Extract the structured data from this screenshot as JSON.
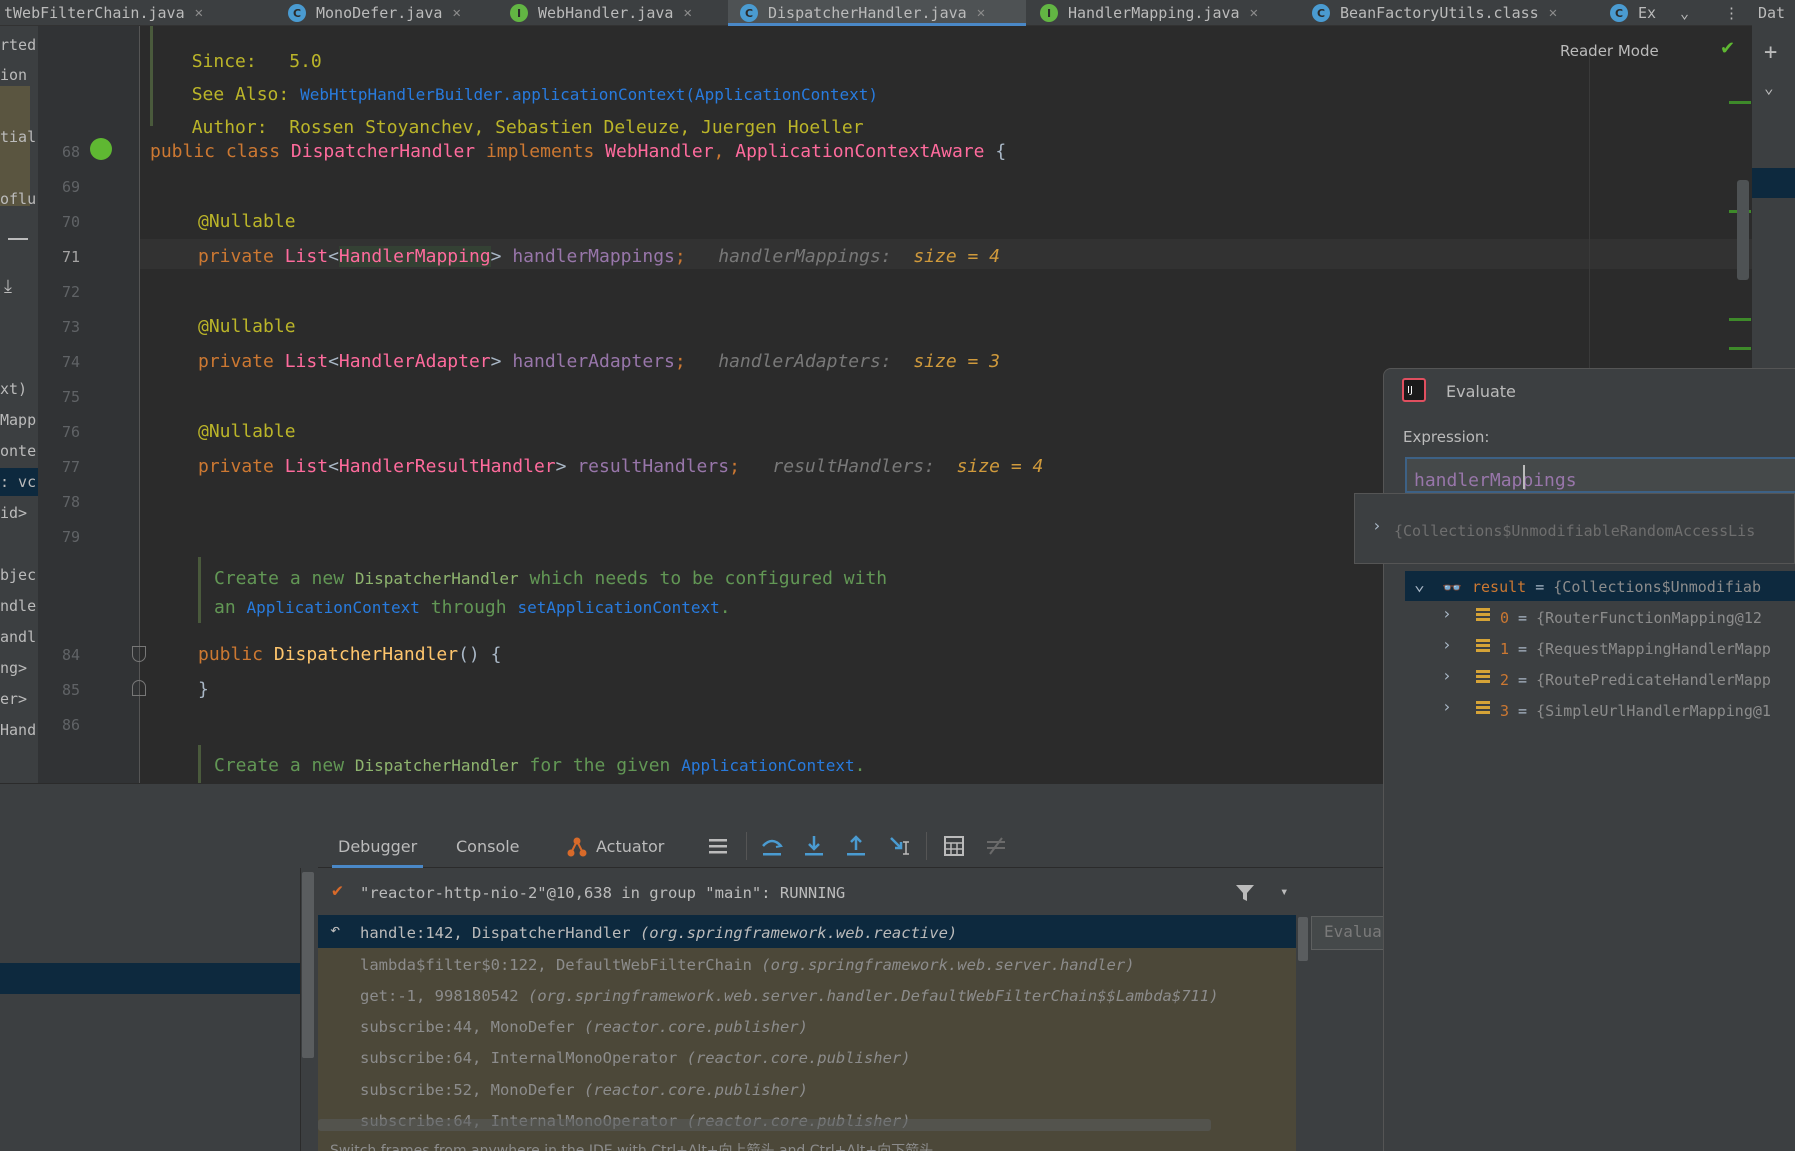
{
  "tabs": [
    {
      "label": "tWebFilterChain.java",
      "icon": "",
      "active": false
    },
    {
      "label": "MonoDefer.java",
      "icon": "C",
      "active": false
    },
    {
      "label": "WebHandler.java",
      "icon": "I",
      "active": false
    },
    {
      "label": "DispatcherHandler.java",
      "icon": "C",
      "active": true
    },
    {
      "label": "HandlerMapping.java",
      "icon": "I",
      "active": false
    },
    {
      "label": "BeanFactoryUtils.class",
      "icon": "C",
      "active": false
    },
    {
      "label": "Ex",
      "icon": "C",
      "active": false
    }
  ],
  "right_stripe_label": "Dat",
  "reader_mode": "Reader Mode",
  "left_panel_fragments": [
    "rted",
    "ion",
    "tial",
    "oflu",
    "xt)",
    "Mapp",
    "onte",
    ": vc",
    "id>",
    "bjec",
    "ndle",
    "andl",
    "ng>",
    "er>",
    "Hand"
  ],
  "editor": {
    "doc_top": {
      "since_tag": "Since:",
      "since_val": "5.0",
      "see_tag": "See Also:",
      "see_val": "WebHttpHandlerBuilder.applicationContext(ApplicationContext)",
      "author_tag": "Author:",
      "author_val": "Rossen Stoyanchev, Sebastien Deleuze, Juergen Hoeller"
    },
    "line_numbers": [
      "68",
      "69",
      "70",
      "71",
      "72",
      "73",
      "74",
      "75",
      "76",
      "77",
      "78",
      "79",
      "84",
      "85",
      "86"
    ],
    "class_decl": {
      "kw1": "public class ",
      "name": "DispatcherHandler",
      "kw2": " implements ",
      "iface1": "WebHandler",
      "comma": ", ",
      "iface2": "ApplicationContextAware",
      "brace": " {"
    },
    "annotation": "@Nullable",
    "fields": [
      {
        "kw": "private ",
        "list": "List",
        "lt": "<",
        "type": "HandlerMapping",
        "gt": "> ",
        "name": "handlerMappings",
        "semi": ";",
        "hint_name": "handlerMappings:",
        "hint_val": "size = 4"
      },
      {
        "kw": "private ",
        "list": "List",
        "lt": "<",
        "type": "HandlerAdapter",
        "gt": "> ",
        "name": "handlerAdapters",
        "semi": ";",
        "hint_name": "handlerAdapters:",
        "hint_val": "size = 3"
      },
      {
        "kw": "private ",
        "list": "List",
        "lt": "<",
        "type": "HandlerResultHandler",
        "gt": "> ",
        "name": "resultHandlers",
        "semi": ";",
        "hint_name": "resultHandlers:",
        "hint_val": "size = 4"
      }
    ],
    "doc1": {
      "p1": "Create a new ",
      "c1": "DispatcherHandler",
      "p2": " which needs to be configured with",
      "p3": "an ",
      "l1": "ApplicationContext",
      "p4": " through ",
      "l2": "setApplicationContext",
      "p5": "."
    },
    "ctor": {
      "kw": "public ",
      "name": "DispatcherHandler",
      "parens": "() {",
      "close": "}"
    },
    "doc2": {
      "p1": "Create a new ",
      "c1": "DispatcherHandler",
      "p2": " for the given ",
      "l1": "ApplicationContext",
      "p3": "."
    }
  },
  "debugger": {
    "tabs": [
      {
        "label": "Debugger",
        "active": true
      },
      {
        "label": "Console",
        "active": false
      },
      {
        "label": "Actuator",
        "active": false
      }
    ],
    "thread": "\"reactor-http-nio-2\"@10,638 in group \"main\": RUNNING",
    "frames": [
      {
        "method": "handle:142, DispatcherHandler",
        "pkg": "(org.springframework.web.reactive)"
      },
      {
        "method": "lambda$filter$0:122, DefaultWebFilterChain",
        "pkg": "(org.springframework.web.server.handler)"
      },
      {
        "method": "get:-1, 998180542",
        "pkg": "(org.springframework.web.server.handler.DefaultWebFilterChain$$Lambda$711)"
      },
      {
        "method": "subscribe:44, MonoDefer",
        "pkg": "(reactor.core.publisher)"
      },
      {
        "method": "subscribe:64, InternalMonoOperator",
        "pkg": "(reactor.core.publisher)"
      },
      {
        "method": "subscribe:52, MonoDefer",
        "pkg": "(reactor.core.publisher)"
      },
      {
        "method": "subscribe:64, InternalMonoOperator",
        "pkg": "(reactor.core.publisher)"
      }
    ],
    "footer_hint": "Switch frames from anywhere in the IDE with Ctrl+Alt+向上箭头 and Ctrl+Alt+向下箭头",
    "eval_side_placeholder": "Evalua"
  },
  "evaluate": {
    "title": "Evaluate",
    "expression_label": "Expression:",
    "expression_value": "handlerMappings",
    "popup_text": "{Collections$UnmodifiableRandomAccessLis",
    "result_label": "result",
    "result_eq": " = ",
    "result_val": "{Collections$Unmodifiab",
    "items": [
      {
        "idx": "0",
        "val": "{RouterFunctionMapping@12"
      },
      {
        "idx": "1",
        "val": "{RequestMappingHandlerMapp"
      },
      {
        "idx": "2",
        "val": "{RoutePredicateHandlerMapp"
      },
      {
        "idx": "3",
        "val": "{SimpleUrlHandlerMapping@1"
      }
    ]
  },
  "colors": {
    "background": "#2b2b2b",
    "keyword": "#cc7832",
    "type": "#ff6b9d",
    "annotation": "#bbb529",
    "field": "#9876aa",
    "selection": "#0d293e",
    "accent": "#4a88c7"
  }
}
